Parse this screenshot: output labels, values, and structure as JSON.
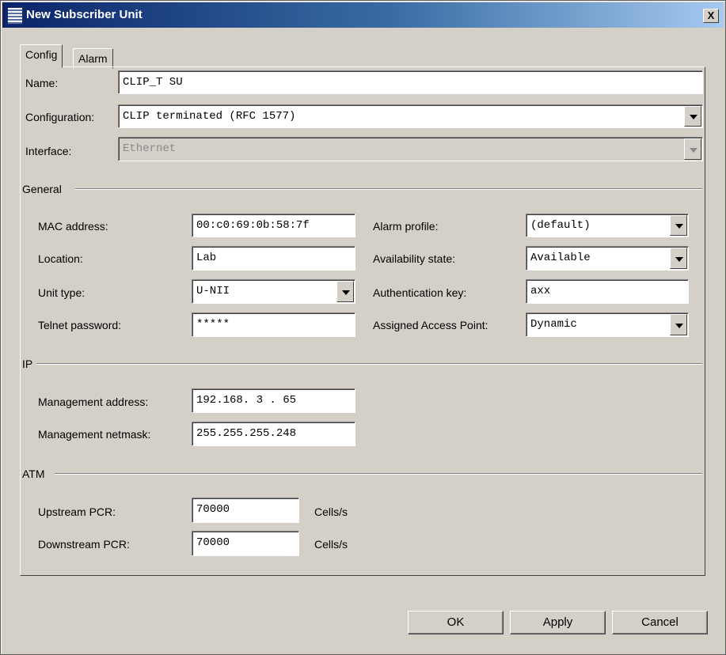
{
  "window": {
    "title": "New Subscriber Unit",
    "close_label": "X"
  },
  "tabs": [
    {
      "label": "Config"
    },
    {
      "label": "Alarm"
    }
  ],
  "config": {
    "name_label": "Name:",
    "name_value": "CLIP_T SU",
    "configuration_label": "Configuration:",
    "configuration_value": "CLIP terminated (RFC 1577)",
    "interface_label": "Interface:",
    "interface_value": "Ethernet"
  },
  "general": {
    "legend": "General",
    "mac_label": "MAC address:",
    "mac_value": "00:c0:69:0b:58:7f",
    "location_label": "Location:",
    "location_value": "Lab",
    "unit_type_label": "Unit type:",
    "unit_type_value": "U-NII",
    "telnet_label": "Telnet password:",
    "telnet_value": "*****",
    "alarm_profile_label": "Alarm profile:",
    "alarm_profile_value": "(default)",
    "availability_label": "Availability state:",
    "availability_value": "Available",
    "auth_key_label": "Authentication key:",
    "auth_key_value": "axx",
    "access_point_label": "Assigned Access Point:",
    "access_point_value": "Dynamic"
  },
  "ip": {
    "legend": "IP",
    "mgmt_address_label": "Management address:",
    "mgmt_address_value": "192.168. 3 . 65",
    "mgmt_netmask_label": "Management netmask:",
    "mgmt_netmask_value": "255.255.255.248"
  },
  "atm": {
    "legend": "ATM",
    "upstream_label": "Upstream PCR:",
    "upstream_value": "70000",
    "upstream_unit": "Cells/s",
    "downstream_label": "Downstream PCR:",
    "downstream_value": "70000",
    "downstream_unit": "Cells/s"
  },
  "buttons": {
    "ok": "OK",
    "apply": "Apply",
    "cancel": "Cancel"
  }
}
